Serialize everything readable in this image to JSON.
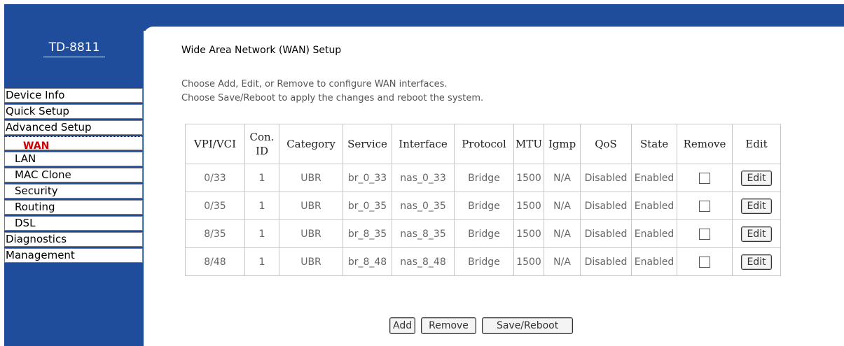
{
  "sidebar": {
    "logo": "TD-8811",
    "items": [
      {
        "label": "Device Info"
      },
      {
        "label": "Quick Setup"
      },
      {
        "label": "Advanced Setup"
      },
      {
        "label": "WAN"
      },
      {
        "label": "LAN"
      },
      {
        "label": "MAC Clone"
      },
      {
        "label": "Security"
      },
      {
        "label": "Routing"
      },
      {
        "label": "DSL"
      },
      {
        "label": "Diagnostics"
      },
      {
        "label": "Management"
      }
    ]
  },
  "main": {
    "title": "Wide Area Network (WAN) Setup",
    "desc1": "Choose Add, Edit, or Remove to configure WAN interfaces.",
    "desc2": "Choose Save/Reboot to apply the changes and reboot the system."
  },
  "table": {
    "headers": [
      "VPI/VCI",
      "Con. ID",
      "Category",
      "Service",
      "Interface",
      "Protocol",
      "MTU",
      "Igmp",
      "QoS",
      "State",
      "Remove",
      "Edit"
    ],
    "rows": [
      [
        "0/33",
        "1",
        "UBR",
        "br_0_33",
        "nas_0_33",
        "Bridge",
        "1500",
        "N/A",
        "Disabled",
        "Enabled"
      ],
      [
        "0/35",
        "1",
        "UBR",
        "br_0_35",
        "nas_0_35",
        "Bridge",
        "1500",
        "N/A",
        "Disabled",
        "Enabled"
      ],
      [
        "8/35",
        "1",
        "UBR",
        "br_8_35",
        "nas_8_35",
        "Bridge",
        "1500",
        "N/A",
        "Disabled",
        "Enabled"
      ],
      [
        "8/48",
        "1",
        "UBR",
        "br_8_48",
        "nas_8_48",
        "Bridge",
        "1500",
        "N/A",
        "Disabled",
        "Enabled"
      ]
    ],
    "edit_label": "Edit"
  },
  "buttons": {
    "add": "Add",
    "remove": "Remove",
    "save_reboot": "Save/Reboot"
  },
  "colors": {
    "frame_blue": "#1f4d9c",
    "active_item": "#cc0000"
  }
}
